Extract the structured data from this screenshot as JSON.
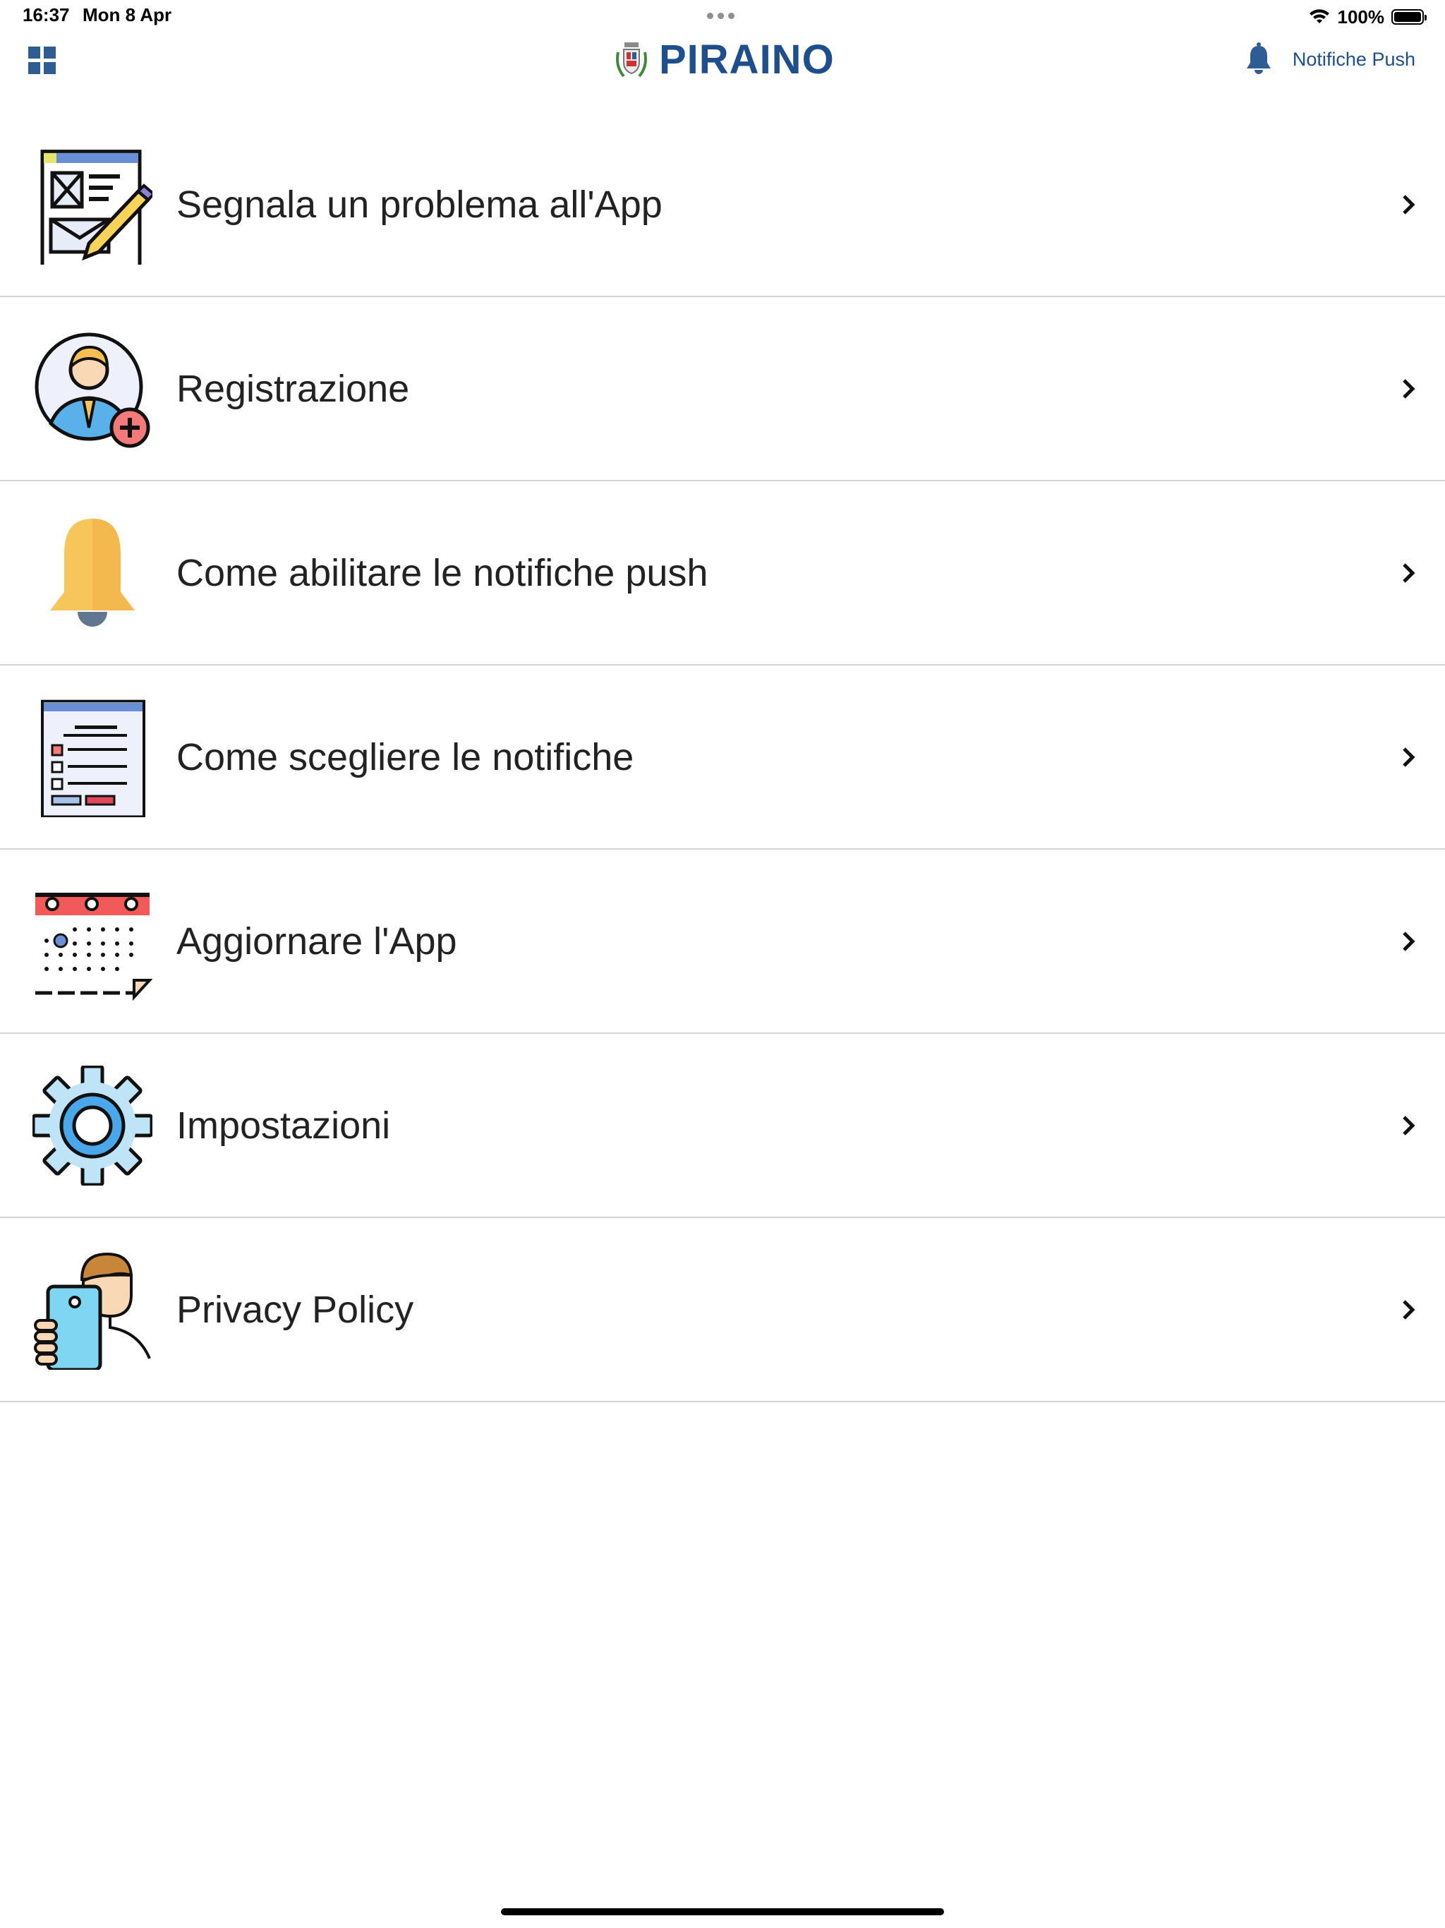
{
  "status_bar": {
    "time": "16:37",
    "date": "Mon 8 Apr",
    "battery": "100%"
  },
  "header": {
    "brand_title": "PIRAINO",
    "push_label": "Notifiche Push"
  },
  "menu": {
    "items": [
      {
        "label": "Segnala un problema all'App",
        "icon": "report-problem-icon"
      },
      {
        "label": "Registrazione",
        "icon": "user-register-icon"
      },
      {
        "label": "Come abilitare le notifiche push",
        "icon": "bell-icon"
      },
      {
        "label": "Come scegliere le notifiche",
        "icon": "checklist-icon"
      },
      {
        "label": "Aggiornare l'App",
        "icon": "calendar-icon"
      },
      {
        "label": "Impostazioni",
        "icon": "gear-icon"
      },
      {
        "label": "Privacy Policy",
        "icon": "privacy-phone-icon"
      }
    ]
  },
  "colors": {
    "brand": "#1e4f8c",
    "divider": "#d4d4d4",
    "bell_yellow": "#f7c65a"
  }
}
